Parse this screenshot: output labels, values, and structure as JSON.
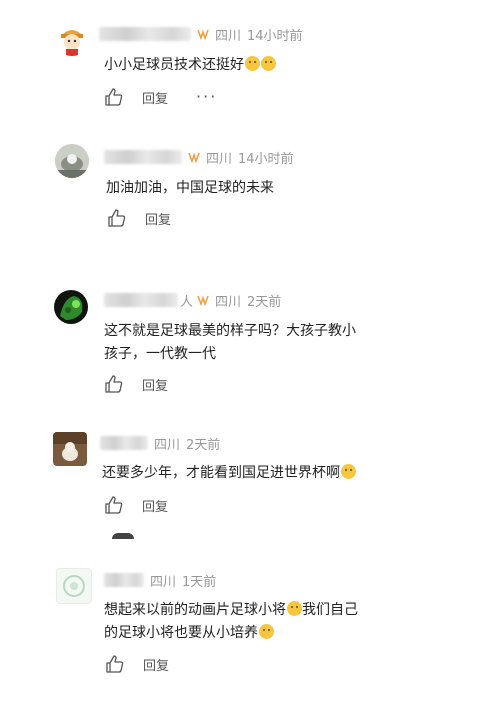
{
  "comments": [
    {
      "location": "四川",
      "time": "14小时前",
      "text": "小小足球员技术还挺好",
      "emoji_after": [
        "cat-emoji",
        "cat-emoji"
      ],
      "reply_label": "回复",
      "more_label": "···"
    },
    {
      "location": "四川",
      "time": "14小时前",
      "text": "加油加油，中国足球的未来",
      "reply_label": "回复"
    },
    {
      "location": "四川",
      "time": "2天前",
      "text_line1": "这不就是足球最美的样子吗？大孩子教小",
      "text_line2": "孩子，一代教一代",
      "username_suffix": "人",
      "reply_label": "回复"
    },
    {
      "location": "四川",
      "time": "2天前",
      "text": "还要多少年，才能看到国足进世界杯啊",
      "emoji_after": [
        "laugh-cry-emoji"
      ],
      "reply_label": "回复"
    },
    {
      "location": "四川",
      "time": "1天前",
      "text_line1a": "想起来以前的动画片足球小将",
      "text_line1b": "我们自己",
      "text_line2": "的足球小将也要从小培养",
      "reply_label": "回复"
    }
  ],
  "colors": {
    "vip": "#f0a040",
    "meta": "#999999",
    "text": "#222222",
    "action": "#555555"
  }
}
